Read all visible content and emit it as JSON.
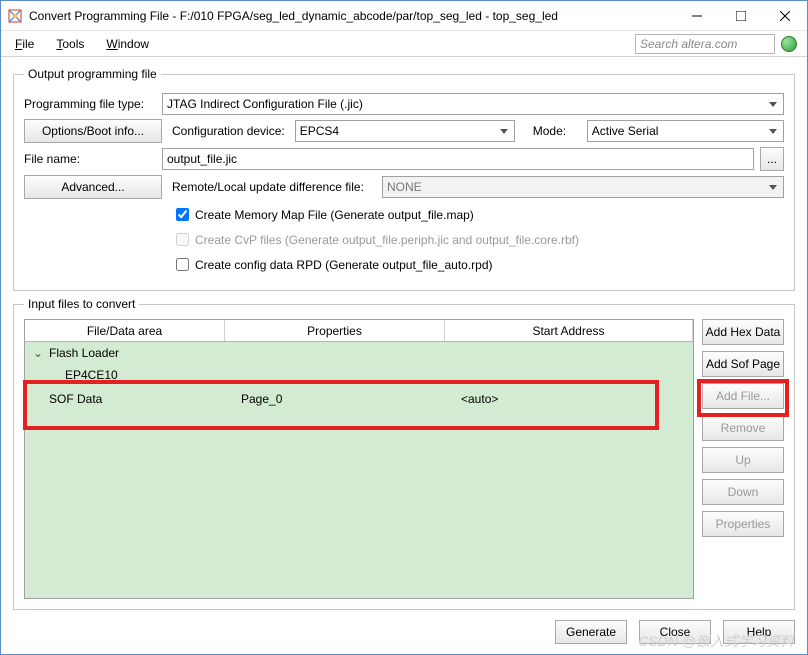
{
  "window": {
    "title": "Convert Programming File - F:/010 FPGA/seg_led_dynamic_abcode/par/top_seg_led - top_seg_led"
  },
  "menu": {
    "file": "File",
    "tools": "Tools",
    "window": "Window"
  },
  "search": {
    "placeholder": "Search altera.com"
  },
  "output": {
    "legend": "Output programming file",
    "file_type_label": "Programming file type:",
    "file_type": "JTAG Indirect Configuration File (.jic)",
    "options_btn": "Options/Boot info...",
    "config_dev_label": "Configuration device:",
    "config_dev": "EPCS4",
    "mode_label": "Mode:",
    "mode": "Active Serial",
    "file_name_label": "File name:",
    "file_name": "output_file.jic",
    "browse": "...",
    "advanced_btn": "Advanced...",
    "remote_label": "Remote/Local update difference file:",
    "remote_value": "NONE",
    "chk1": "Create Memory Map File (Generate output_file.map)",
    "chk2": "Create CvP files (Generate output_file.periph.jic and output_file.core.rbf)",
    "chk3": "Create config data RPD (Generate output_file_auto.rpd)"
  },
  "input": {
    "legend": "Input files to convert",
    "col1": "File/Data area",
    "col2": "Properties",
    "col3": "Start Address",
    "rows": {
      "flash_loader": "Flash Loader",
      "device": "EP4CE10",
      "sof_data": "SOF Data",
      "sof_prop": "Page_0",
      "sof_addr": "<auto>"
    },
    "side": {
      "add_hex": "Add Hex Data",
      "add_sof": "Add Sof Page",
      "add_file": "Add File...",
      "remove": "Remove",
      "up": "Up",
      "down": "Down",
      "properties": "Properties"
    }
  },
  "bottom": {
    "generate": "Generate",
    "close": "Close",
    "help": "Help"
  },
  "watermark": "CSDN @嵌入式学习资料"
}
